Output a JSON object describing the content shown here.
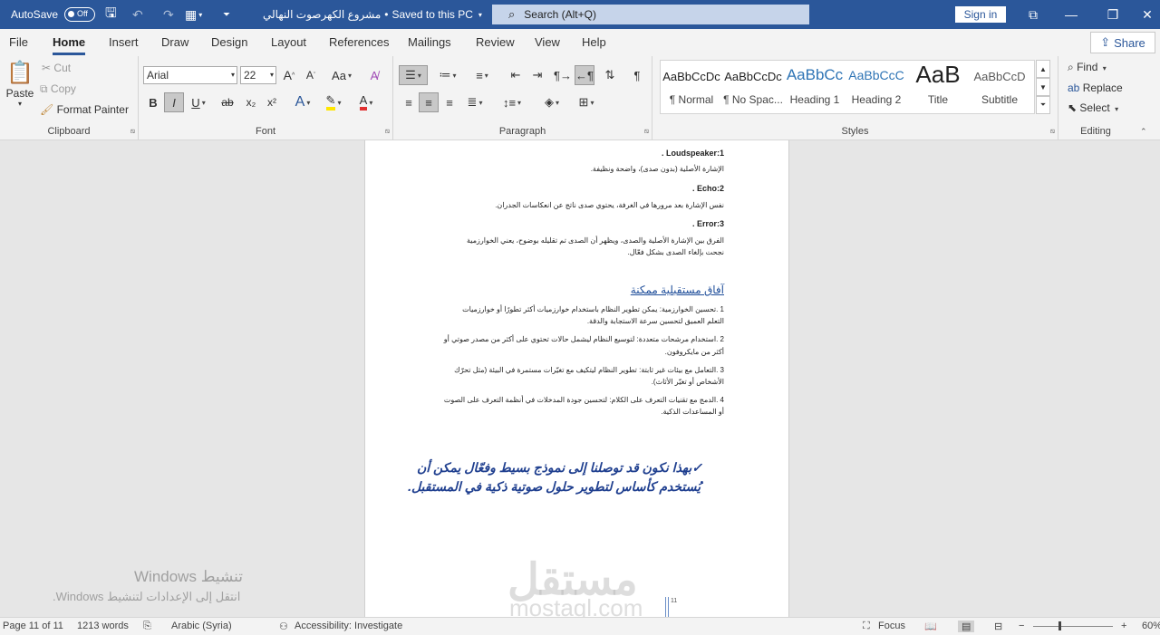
{
  "titlebar": {
    "autosave_label": "AutoSave",
    "autosave_state": "Off",
    "doc_title": "مشروع الكهرصوت النهالي",
    "save_status": "Saved to this PC",
    "search_placeholder": "Search (Alt+Q)",
    "signin_label": "Sign in"
  },
  "tabs": [
    "File",
    "Home",
    "Insert",
    "Draw",
    "Design",
    "Layout",
    "References",
    "Mailings",
    "Review",
    "View",
    "Help"
  ],
  "active_tab": "Home",
  "share_label": "Share",
  "clipboard": {
    "paste": "Paste",
    "cut": "Cut",
    "copy": "Copy",
    "format_painter": "Format Painter",
    "label": "Clipboard"
  },
  "font": {
    "name": "Arial",
    "size": "22",
    "label": "Font",
    "grow": "A",
    "shrink": "A",
    "case": "Aa",
    "bold": "B",
    "italic": "I",
    "underline": "U",
    "strike": "ab",
    "sub": "x₂",
    "sup": "x²",
    "color_a": "A"
  },
  "paragraph": {
    "label": "Paragraph"
  },
  "styles": {
    "label": "Styles",
    "items": [
      {
        "preview": "AaBbCcDc",
        "name": "¶ Normal"
      },
      {
        "preview": "AaBbCcDc",
        "name": "¶ No Spac..."
      },
      {
        "preview": "AaBbCc",
        "name": "Heading 1"
      },
      {
        "preview": "AaBbCcC",
        "name": "Heading 2"
      },
      {
        "preview": "AaB",
        "name": "Title"
      },
      {
        "preview": "AaBbCcD",
        "name": "Subtitle"
      }
    ]
  },
  "editing": {
    "find": "Find",
    "replace": "Replace",
    "select": "Select",
    "label": "Editing"
  },
  "document": {
    "item1_head": "Loudspeaker:1 .",
    "item1_text": "الإشارة الأصلية (بدون صدى)، واضحة ونظيفة.",
    "item2_head": "Echo:2 .",
    "item2_text": "نفس الإشارة بعد مرورها في الغرفة، يحتوي صدى ناتج عن انعكاسات الجدران.",
    "item3_head": "Error:3 .",
    "item3_text_1": "الفرق بين الإشارة الأصلية والصدى، ويظهر أن الصدى تم تقليله بوضوح، يعني الخوارزمية",
    "item3_text_2": "نجحت بإلغاء الصدى بشكل فعّال.",
    "heading": "آفاق مستقبلية ممكنة",
    "list1_a": "1 .تحسين الخوارزمية: يمكن تطوير النظام باستخدام خوارزميات أكثر تطورًا أو خوارزميات",
    "list1_b": "التعلم العميق لتحسين سرعة الاستجابة والدقة.",
    "list2_a": "2 .استخدام مرشحات متعددة: لتوسيع النظام ليشمل حالات تحتوي على أكثر من مصدر صوتي أو",
    "list2_b": "أكثر من مايكروفون.",
    "list3_a": "3 .التعامل مع بيئات غير ثابتة: تطوير النظام ليتكيف مع تغيّرات مستمرة في البيئة (مثل تحرّك",
    "list3_b": "الأشخاص أو تغيّر الأثاث).",
    "list4_a": "4 .الدمج مع تقنيات التعرف على الكلام: لتحسين جودة المدخلات في أنظمة التعرف على الصوت",
    "list4_b": "أو المساعدات الذكية.",
    "closing_1": "✓بهذا نكون قد توصلنا إلى نموذج بسيط وفعّال يمكن أن",
    "closing_2": "يُستخدم كأساس لتطوير حلول صوتية ذكية في المستقبل.",
    "page_number": "11"
  },
  "statusbar": {
    "page": "Page 11 of 11",
    "words": "1213 words",
    "language": "Arabic (Syria)",
    "accessibility": "Accessibility: Investigate",
    "focus": "Focus",
    "zoom": "60%"
  },
  "overlay": {
    "activate_title": "تنشيط Windows",
    "activate_sub": "انتقل إلى الإعدادات لتنشيط Windows.",
    "watermark_ar": "مستقل",
    "watermark_en": "mostaql.com"
  },
  "colors": {
    "titlebar": "#2b579a",
    "accent": "#2b579a",
    "heading_link": "#1f4e9a",
    "closing_text": "#1f3f8f",
    "highlight_yellow": "#ffe600",
    "font_red": "#e03030"
  }
}
